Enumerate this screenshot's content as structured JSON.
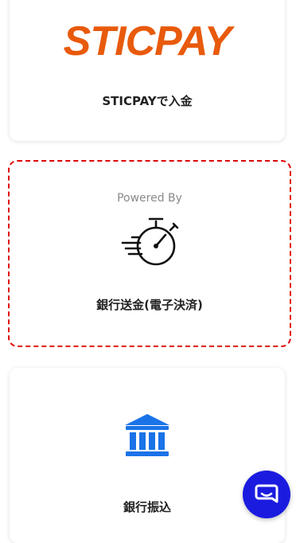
{
  "payment_methods": [
    {
      "logo_text": "STICPAY",
      "label": "STICPAYで入金"
    },
    {
      "powered_by": "Powered By",
      "icon": "stopwatch-icon",
      "label": "銀行送金(電子決済)"
    },
    {
      "icon": "bank-icon",
      "label": "銀行振込"
    }
  ],
  "colors": {
    "sticpay_brand": "#e85a0c",
    "highlight_border": "#e00000",
    "bank_icon": "#1a73e8",
    "chat_button": "#1b1be0"
  },
  "chat": {
    "icon": "chat-icon"
  }
}
